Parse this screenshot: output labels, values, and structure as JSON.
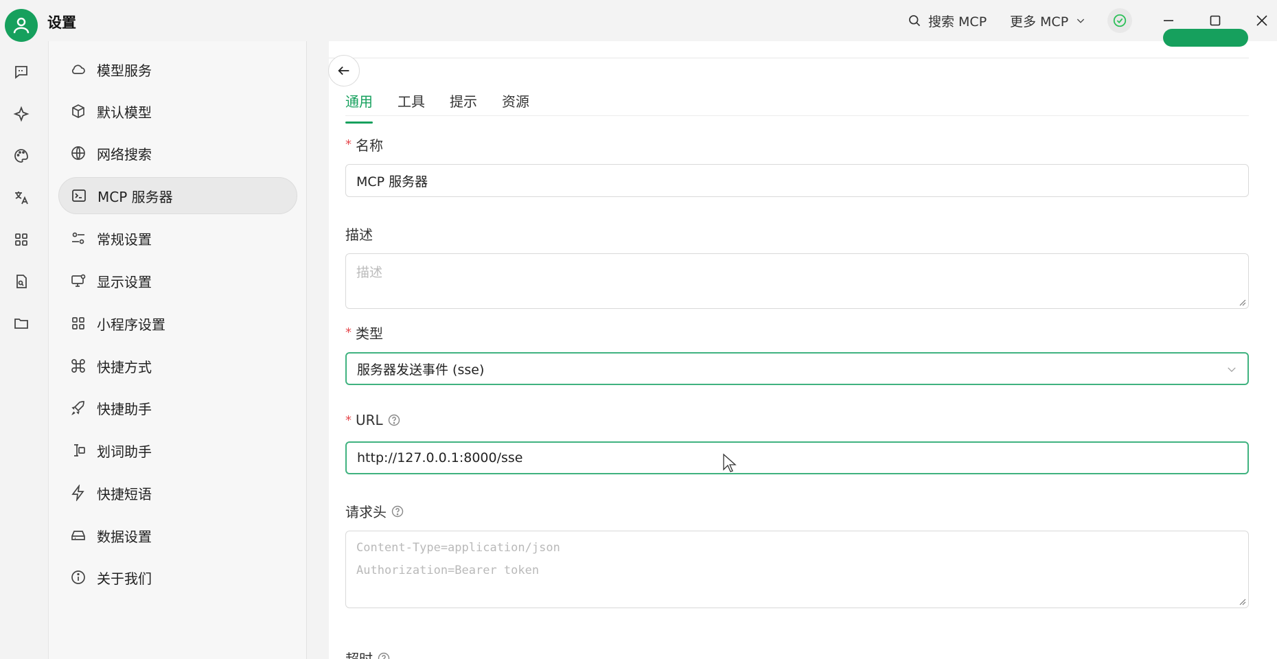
{
  "app": {
    "title": "设置"
  },
  "titlebar": {
    "search_label": "搜索 MCP",
    "more_label": "更多 MCP",
    "status_icon": "check-circle-icon"
  },
  "nav": {
    "items": [
      {
        "label": "模型服务",
        "icon": "cloud-icon"
      },
      {
        "label": "默认模型",
        "icon": "cube-icon"
      },
      {
        "label": "网络搜索",
        "icon": "globe-icon"
      },
      {
        "label": "MCP 服务器",
        "icon": "terminal-icon",
        "active": true
      },
      {
        "label": "常规设置",
        "icon": "sliders-icon"
      },
      {
        "label": "显示设置",
        "icon": "monitor-icon"
      },
      {
        "label": "小程序设置",
        "icon": "grid-icon"
      },
      {
        "label": "快捷方式",
        "icon": "command-icon"
      },
      {
        "label": "快捷助手",
        "icon": "rocket-icon"
      },
      {
        "label": "划词助手",
        "icon": "text-cursor-icon"
      },
      {
        "label": "快捷短语",
        "icon": "bolt-icon"
      },
      {
        "label": "数据设置",
        "icon": "hard-drive-icon"
      },
      {
        "label": "关于我们",
        "icon": "info-icon"
      }
    ]
  },
  "tabs": [
    {
      "label": "通用",
      "active": true
    },
    {
      "label": "工具"
    },
    {
      "label": "提示"
    },
    {
      "label": "资源"
    }
  ],
  "form": {
    "name_label": "名称",
    "name_value": "MCP 服务器",
    "desc_label": "描述",
    "desc_placeholder": "描述",
    "type_label": "类型",
    "type_value": "服务器发送事件 (sse)",
    "url_label": "URL",
    "url_value": "http://127.0.0.1:8000/sse",
    "headers_label": "请求头",
    "headers_placeholder_line1": "Content-Type=application/json",
    "headers_placeholder_line2": "Authorization=Bearer token",
    "timeout_label": "超时"
  },
  "colors": {
    "accent": "#16a05d",
    "required": "#e5484d"
  }
}
